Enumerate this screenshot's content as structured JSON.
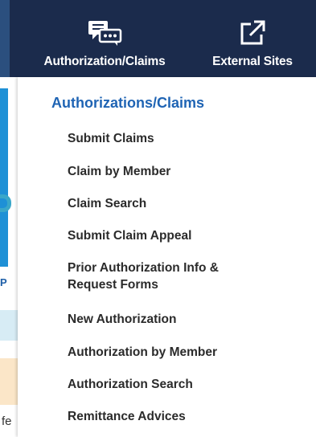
{
  "topnav": {
    "items": [
      {
        "label": "Authorization/Claims",
        "icon": "chat-bubbles-icon"
      },
      {
        "label": "External Sites",
        "icon": "external-link-icon"
      }
    ]
  },
  "background": {
    "partial_text_p": "P",
    "partial_text_f": "fe"
  },
  "dropdown": {
    "heading": "Authorizations/Claims",
    "items": [
      {
        "label": "Submit Claims"
      },
      {
        "label": "Claim by Member"
      },
      {
        "label": "Claim Search"
      },
      {
        "label": "Submit Claim Appeal"
      },
      {
        "label_line1": "Prior Authorization Info &",
        "label_line2": "Request Forms"
      },
      {
        "label": "New Authorization"
      },
      {
        "label": "Authorization by Member"
      },
      {
        "label": "Authorization Search"
      },
      {
        "label": "Remittance Advices"
      }
    ]
  },
  "colors": {
    "topbar": "#1b2b4c",
    "heading": "#1f64b4",
    "menu_text": "#2b2b2b"
  }
}
